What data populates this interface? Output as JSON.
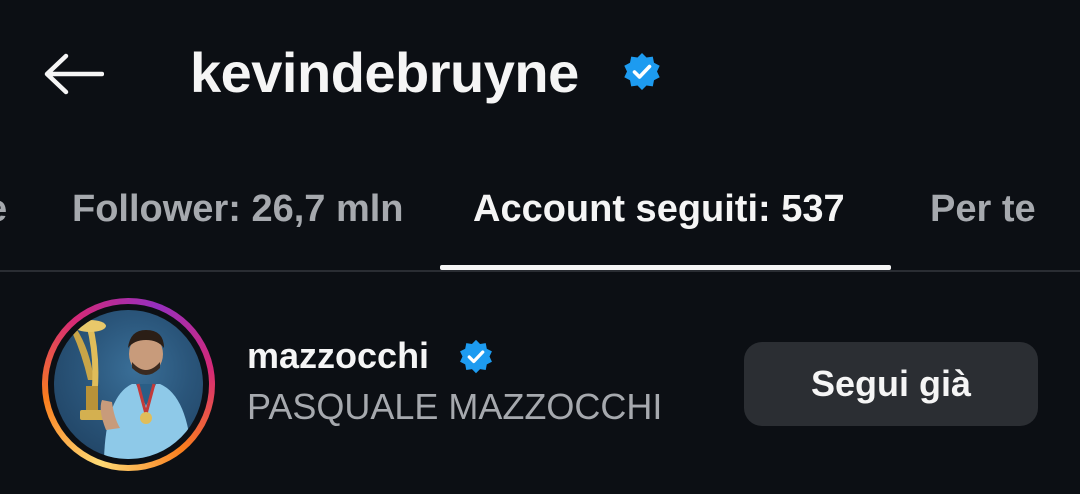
{
  "header": {
    "back_icon": "arrow-left-icon",
    "title": "kevindebruyne",
    "verified_icon": "verified-badge-icon"
  },
  "tabs": [
    {
      "label": "e",
      "active": false
    },
    {
      "label": "Follower: 26,7 mln",
      "active": false
    },
    {
      "label": "Account seguiti: 537",
      "active": true
    },
    {
      "label": "Per te",
      "active": false
    }
  ],
  "list": {
    "items": [
      {
        "username": "mazzocchi",
        "verified_icon": "verified-badge-icon",
        "full_name": "PASQUALE MAZZOCCHI",
        "button_label": "Segui già",
        "avatar_icon": "profile-photo"
      }
    ]
  },
  "colors": {
    "background": "#0c0f14",
    "text_primary": "#f5f5f5",
    "text_secondary": "#a6a9ae",
    "verified_blue": "#1d9bf0",
    "button_bg": "#2b2e33",
    "divider": "#2a2d33"
  }
}
